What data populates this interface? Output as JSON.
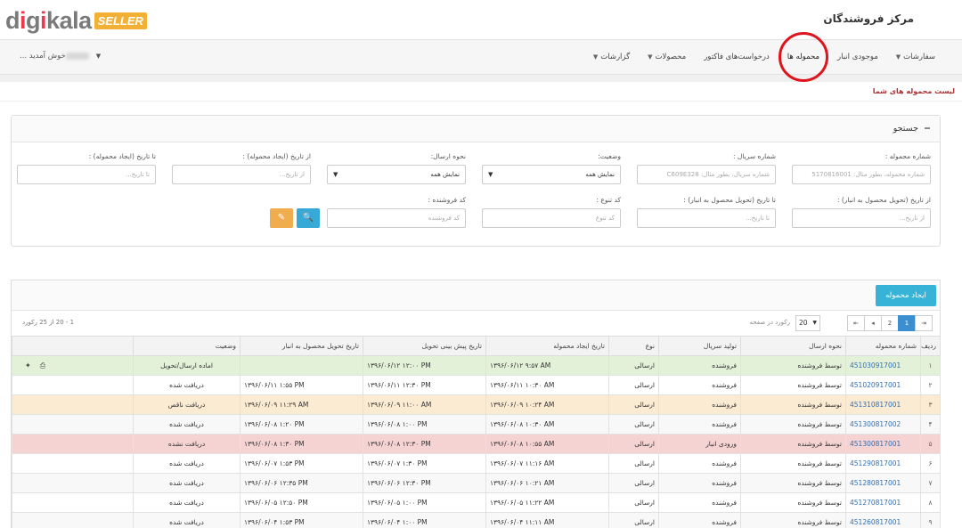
{
  "header": {
    "logo_text": "digikala",
    "logo_badge": "SELLER",
    "site_title": "مرکز فروشندگان"
  },
  "nav": {
    "items": [
      {
        "label": "سفارشات",
        "caret": "▼"
      },
      {
        "label": "موجودی انبار",
        "caret": ""
      },
      {
        "label": "محموله ها",
        "caret": ""
      },
      {
        "label": "درخواست‌های فاکتور",
        "caret": ""
      },
      {
        "label": "محصولات",
        "caret": "▼"
      },
      {
        "label": "گزارشات",
        "caret": "▼"
      }
    ],
    "welcome": "خوش آمدید ..."
  },
  "section_title": "لیست محموله های شما",
  "search": {
    "title": "جستجو",
    "toggle": "−",
    "fields": {
      "shipment_number": {
        "label": "شماره محموله :",
        "placeholder": "شماره محموله، بطور مثال: 5170816001"
      },
      "serial_number": {
        "label": "شماره سریال :",
        "placeholder": "شماره سریال، بطور مثال: C609E328"
      },
      "status": {
        "label": "وضعیت:",
        "value": "نمایش همه"
      },
      "send_method": {
        "label": "نحوه ارسال:",
        "value": "نمایش همه"
      },
      "from_created": {
        "label": "از تاریخ (ایجاد محموله) :",
        "placeholder": "از تاریخ..."
      },
      "to_created": {
        "label": "تا تاریخ (ایجاد محموله) :",
        "placeholder": "تا تاریخ..."
      },
      "from_delivery": {
        "label": "از تاریخ (تحویل محصول به انبار) :",
        "placeholder": "از تاریخ..."
      },
      "to_delivery": {
        "label": "تا تاریخ (تحویل محصول به انبار) :",
        "placeholder": "تا تاریخ..."
      },
      "variety_code": {
        "label": "کد تنوع :",
        "placeholder": "کد تنوع"
      },
      "seller_code": {
        "label": "کد فروشنده :",
        "placeholder": "کد فروشنده"
      }
    },
    "search_icon": "🔍",
    "clear_icon": "✎"
  },
  "list": {
    "create_button": "ایجاد محموله",
    "pager": {
      "first": "⇤",
      "prev": "◂",
      "page1": "1",
      "page2": "2",
      "next": "▸",
      "last": "⇥",
      "per_page": "20",
      "per_page_label": "رکورد در صفحه",
      "range": "1 - 20 از 25 رکورد"
    },
    "columns": [
      "ردیف",
      "شماره محموله",
      "نحوه ارسال",
      "تولید سریال",
      "نوع",
      "تاریخ ایجاد محموله",
      "تاریخ پیش بینی تحویل",
      "تاریخ تحویل محصول به انبار",
      "وضعیت",
      ""
    ],
    "rows": [
      {
        "idx": "۱",
        "number": "451030917001",
        "send": "توسط فروشنده",
        "serial": "فروشنده",
        "type": "ارسالی",
        "created": "۱۳۹۶/۰۶/۱۲ ۹:۵۷ AM",
        "forecast": "۱۳۹۶/۰۶/۱۲ ۱۲:۰۰ PM",
        "delivered": "",
        "status": "اماده ارسال/تحویل",
        "tone": "r-green",
        "actions": true
      },
      {
        "idx": "۲",
        "number": "451020917001",
        "send": "توسط فروشنده",
        "serial": "فروشنده",
        "type": "ارسالی",
        "created": "۱۳۹۶/۰۶/۱۱ ۱۰:۳۰ AM",
        "forecast": "۱۳۹۶/۰۶/۱۱ ۱۲:۳۰ PM",
        "delivered": "۱۳۹۶/۰۶/۱۱ ۱:۵۵ PM",
        "status": "دریافت شده",
        "tone": "r-white",
        "actions": false
      },
      {
        "idx": "۳",
        "number": "451310817001",
        "send": "توسط فروشنده",
        "serial": "فروشنده",
        "type": "ارسالی",
        "created": "۱۳۹۶/۰۶/۰۹ ۱۰:۲۴ AM",
        "forecast": "۱۳۹۶/۰۶/۰۹ ۱۱:۰۰ AM",
        "delivered": "۱۳۹۶/۰۶/۰۹ ۱۱:۲۹ AM",
        "status": "دریافت ناقص",
        "tone": "r-orange",
        "actions": false
      },
      {
        "idx": "۴",
        "number": "451300817002",
        "send": "توسط فروشنده",
        "serial": "فروشنده",
        "type": "ارسالی",
        "created": "۱۳۹۶/۰۶/۰۸ ۱۰:۳۰ AM",
        "forecast": "۱۳۹۶/۰۶/۰۸ ۱:۰۰ PM",
        "delivered": "۱۳۹۶/۰۶/۰۸ ۱:۲۰ PM",
        "status": "دریافت شده",
        "tone": "r-alt",
        "actions": false
      },
      {
        "idx": "۵",
        "number": "451300817001",
        "send": "توسط فروشنده",
        "serial": "ورودی انبار",
        "type": "ارسالی",
        "created": "۱۳۹۶/۰۶/۰۸ ۱۰:۵۵ AM",
        "forecast": "۱۳۹۶/۰۶/۰۸ ۱۲:۳۰ PM",
        "delivered": "۱۳۹۶/۰۶/۰۸ ۱:۳۰ PM",
        "status": "دریافت نشده",
        "tone": "r-red",
        "actions": false
      },
      {
        "idx": "۶",
        "number": "451290817001",
        "send": "توسط فروشنده",
        "serial": "فروشنده",
        "type": "ارسالی",
        "created": "۱۳۹۶/۰۶/۰۷ ۱۱:۱۶ AM",
        "forecast": "۱۳۹۶/۰۶/۰۷ ۱:۳۰ PM",
        "delivered": "۱۳۹۶/۰۶/۰۷ ۱:۵۳ PM",
        "status": "دریافت شده",
        "tone": "r-white",
        "actions": false
      },
      {
        "idx": "۷",
        "number": "451280817001",
        "send": "توسط فروشنده",
        "serial": "فروشنده",
        "type": "ارسالی",
        "created": "۱۳۹۶/۰۶/۰۶ ۱۰:۲۱ AM",
        "forecast": "۱۳۹۶/۰۶/۰۶ ۱۲:۳۰ PM",
        "delivered": "۱۳۹۶/۰۶/۰۶ ۱۲:۳۵ PM",
        "status": "دریافت شده",
        "tone": "r-alt",
        "actions": false
      },
      {
        "idx": "۸",
        "number": "451270817001",
        "send": "توسط فروشنده",
        "serial": "فروشنده",
        "type": "ارسالی",
        "created": "۱۳۹۶/۰۶/۰۵ ۱۱:۲۲ AM",
        "forecast": "۱۳۹۶/۰۶/۰۵ ۱:۰۰ PM",
        "delivered": "۱۳۹۶/۰۶/۰۵ ۱۲:۵۰ PM",
        "status": "دریافت شده",
        "tone": "r-white",
        "actions": false
      },
      {
        "idx": "۹",
        "number": "451260817001",
        "send": "توسط فروشنده",
        "serial": "فروشنده",
        "type": "ارسالی",
        "created": "۱۳۹۶/۰۶/۰۴ ۱۱:۱۱ AM",
        "forecast": "۱۳۹۶/۰۶/۰۴ ۱:۰۰ PM",
        "delivered": "۱۳۹۶/۰۶/۰۴ ۱:۵۳ PM",
        "status": "دریافت شده",
        "tone": "r-alt",
        "actions": false
      }
    ],
    "action_icons": {
      "print": "⎙",
      "tag": "✦"
    }
  }
}
